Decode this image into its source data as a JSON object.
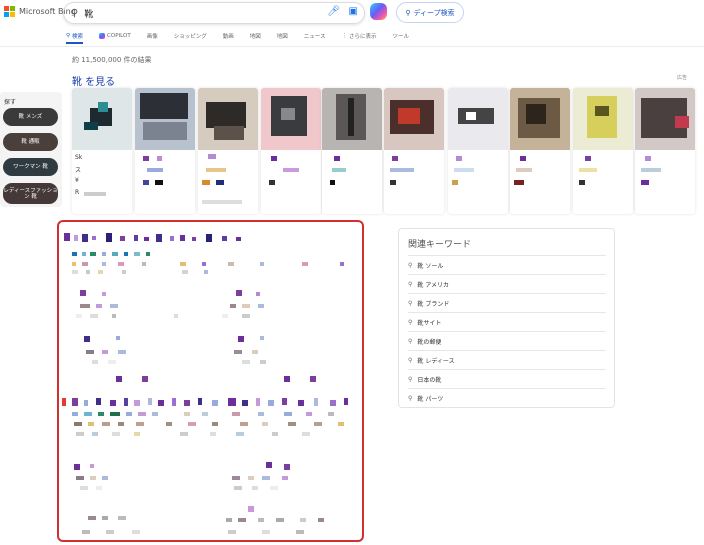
{
  "header": {
    "logo_text": "Microsoft Bing",
    "search_query": "靴",
    "deep_search_label": "ディープ検索",
    "tabs": [
      {
        "label": "検索",
        "icon": "search-icon",
        "active": true
      },
      {
        "label": "COPILOT",
        "icon": "copilot-icon",
        "active": false
      },
      {
        "label": "画像",
        "icon": "",
        "active": false
      },
      {
        "label": "ショッピング",
        "icon": "",
        "active": false
      },
      {
        "label": "動画",
        "icon": "",
        "active": false
      },
      {
        "label": "地図",
        "icon": "",
        "active": false
      },
      {
        "label": "地図",
        "icon": "",
        "active": false
      },
      {
        "label": "ニュース",
        "icon": "",
        "active": false
      },
      {
        "label": "さらに表示",
        "icon": "more-icon",
        "active": false
      },
      {
        "label": "ツール",
        "icon": "",
        "active": false
      }
    ]
  },
  "results_count": "約 11,500,000 件の結果",
  "images": {
    "heading": "靴 を見る",
    "feedback": "広告",
    "explore_title": "探す",
    "chips": [
      "靴 メンズ",
      "靴 通販",
      "ワークマン 靴",
      "レディースファッション 靴"
    ],
    "cards": [
      {
        "line1": "Sk",
        "line2": "ス",
        "line3": "¥",
        "line4": "R"
      },
      {
        "line1": "",
        "line2": "",
        "line3": "",
        "line4": ""
      },
      {
        "line1": "",
        "line2": "",
        "line3": "",
        "line4": ""
      },
      {
        "line1": "",
        "line2": "",
        "line3": "",
        "line4": ""
      },
      {
        "line1": "",
        "line2": "",
        "line3": "",
        "line4": ""
      },
      {
        "line1": "",
        "line2": "",
        "line3": "",
        "line4": ""
      },
      {
        "line1": "",
        "line2": "",
        "line3": "",
        "line4": ""
      },
      {
        "line1": "",
        "line2": "",
        "line3": "",
        "line4": ""
      },
      {
        "line1": "",
        "line2": "",
        "line3": "",
        "line4": ""
      },
      {
        "line1": "",
        "line2": "",
        "line3": "",
        "line4": ""
      }
    ]
  },
  "related": {
    "title": "関連キーワード",
    "items": [
      "靴 ソール",
      "靴 アメリカ",
      "靴 ブランド",
      "靴サイト",
      "靴の郵便",
      "靴 レディース",
      "日本の靴",
      "靴 パーツ"
    ]
  },
  "colors": {
    "accent": "#1a56c4",
    "highlight_border": "#d32f2f"
  }
}
